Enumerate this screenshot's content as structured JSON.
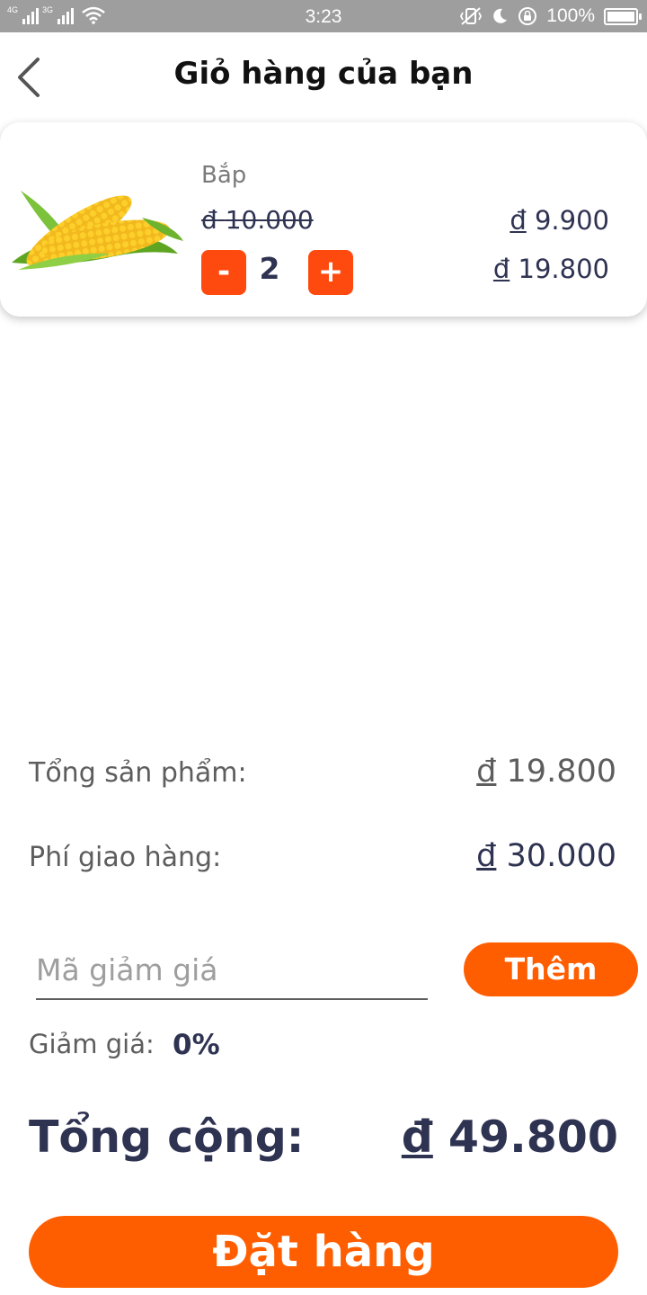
{
  "status_bar": {
    "network_1": "4G",
    "network_2": "3G",
    "time": "3:23",
    "battery_percent": "100%",
    "battery_level": 1.0,
    "icons": [
      "signal-icon",
      "wifi-icon",
      "vibrate-icon",
      "moon-icon",
      "rotation-lock-icon",
      "battery-icon"
    ]
  },
  "header": {
    "back_icon": "chevron-left-icon",
    "title": "Giỏ hàng của bạn"
  },
  "cart": {
    "items": [
      {
        "image_icon": "corn-image",
        "name": "Bắp",
        "currency_symbol": "đ",
        "old_price": "10.000",
        "unit_price": "9.900",
        "quantity": "2",
        "line_total": "19.800",
        "minus_label": "-",
        "plus_label": "+"
      }
    ]
  },
  "summary": {
    "currency_symbol": "đ",
    "subtotal_label": "Tổng sản phẩm:",
    "subtotal_value": "19.800",
    "shipping_label": "Phí giao hàng:",
    "shipping_value": "30.000",
    "coupon_placeholder": "Mã giảm giá",
    "coupon_value": "",
    "add_coupon_label": "Thêm",
    "discount_label": "Giảm giá:",
    "discount_value": "0%",
    "total_label": "Tổng cộng:",
    "total_value": "49.800"
  },
  "actions": {
    "order_label": "Đặt hàng"
  },
  "colors": {
    "accent": "#ff5e00",
    "qty_button": "#ff4a0f",
    "text_dark": "#2f3352",
    "text_muted": "#5d5d5d",
    "status_bar": "#9e9e9e"
  }
}
